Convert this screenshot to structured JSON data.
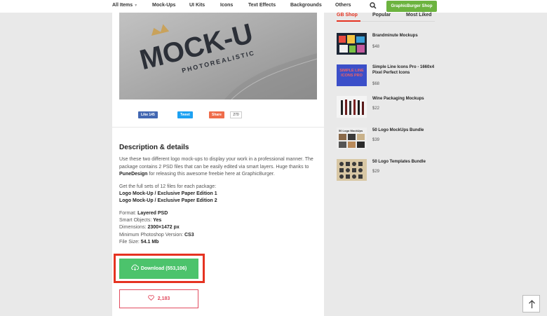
{
  "nav": {
    "items": [
      {
        "label": "All Items"
      },
      {
        "label": "Mock-Ups"
      },
      {
        "label": "UI Kits"
      },
      {
        "label": "Icons"
      },
      {
        "label": "Text Effects"
      },
      {
        "label": "Backgrounds"
      },
      {
        "label": "Others"
      }
    ],
    "shop_label": "GraphicBurger Shop",
    "search_icon": "search-icon",
    "dropdown_icon": "chevron-down-icon"
  },
  "preview": {
    "logo_text": "MOCK-U",
    "logo_subtext": "PHOTOREALISTIC"
  },
  "share": {
    "facebook_label": "Like 145",
    "twitter_label": "Tweet",
    "share_label": "Share",
    "share_count": "270"
  },
  "description": {
    "title": "Description & details",
    "intro_pre": "Use these two different logo mock-ups to display your work in a professional manner. The package contains 2 PSD files that can be easily edited via smart layers. Huge thanks to ",
    "author": "PuneDesign",
    "intro_post": " for releasing this awesome freebie here at GraphicBurger.",
    "full_sets_text": "Get the full sets of 12 files for each package:",
    "links": [
      "Logo Mock-Up / Exclusive Paper Edition 1",
      "Logo Mock-Up / Exclusive Paper Edition 2"
    ],
    "specs": [
      {
        "label": "Format:",
        "value": "Layered PSD"
      },
      {
        "label": "Smart Objects:",
        "value": "Yes"
      },
      {
        "label": "Dimensions:",
        "value": "2300×1472 px"
      },
      {
        "label": "Minimum Photoshop Version:",
        "value": "CS3"
      },
      {
        "label": "File Size:",
        "value": "54.1 Mb"
      }
    ]
  },
  "download": {
    "label": "Download (553,106)",
    "icon": "cloud-download-icon"
  },
  "like": {
    "count": "2,183",
    "icon": "heart-icon"
  },
  "sidebar": {
    "tabs": [
      {
        "label": "GB Shop"
      },
      {
        "label": "Popular"
      },
      {
        "label": "Most Liked"
      }
    ],
    "products": [
      {
        "name": "Brandminute Mockups",
        "price": "$48"
      },
      {
        "name": "Simple Line Icons Pro - 1660x4 Pixel Perfect Icons",
        "price": "$68"
      },
      {
        "name": "Wine Packaging Mockups",
        "price": "$22"
      },
      {
        "name": "50 Logo MockUps Bundle",
        "price": "$39"
      },
      {
        "name": "50 Logo Templates Bundle",
        "price": "$29"
      }
    ],
    "thumb_text": {
      "simple": "SIMPLE LINE ICONS PRO",
      "logo": "50 Logo MockUps"
    }
  },
  "colors": {
    "accent_red": "#e53321",
    "download_green": "#4cc36c",
    "shop_green": "#6cb33f",
    "like_pink": "#e24b5f"
  }
}
